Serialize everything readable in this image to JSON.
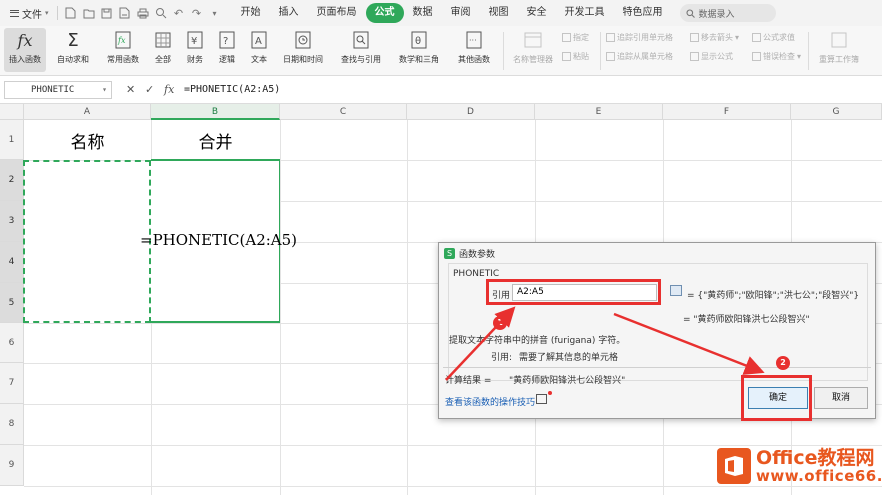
{
  "menubar": {
    "file_label": "文件",
    "tabs": [
      "开始",
      "插入",
      "页面布局",
      "公式",
      "数据",
      "审阅",
      "视图",
      "安全",
      "开发工具",
      "特色应用"
    ],
    "active_tab": "公式",
    "search_placeholder": "数据录入"
  },
  "ribbon": {
    "insert_function": "插入函数",
    "autosum": "自动求和",
    "common_functions": "常用函数",
    "all": "全部",
    "finance": "财务",
    "logic": "逻辑",
    "text": "文本",
    "datetime": "日期和时间",
    "lookup": "查找与引用",
    "math": "数学和三角",
    "other": "其他函数",
    "name_manager": "名称管理器",
    "specify": "指定",
    "paste": "粘贴",
    "trace_precedents": "追踪引用单元格",
    "trace_dependents": "追踪从属单元格",
    "remove_arrows": "移去箭头",
    "show_formulas": "显示公式",
    "formula_eval": "公式求值",
    "error_check": "错误检查",
    "recalc": "重算工作簿"
  },
  "formula_bar": {
    "name_box": "PHONETIC",
    "formula": "=PHONETIC(A2:A5)",
    "fx_label": "fx"
  },
  "grid": {
    "columns": [
      "A",
      "B",
      "C",
      "D",
      "E",
      "F",
      "G"
    ],
    "rows": [
      "1",
      "2",
      "3",
      "4",
      "5",
      "6",
      "7",
      "8",
      "9"
    ],
    "a1": "名称",
    "b1": "合并",
    "b_formula": "=PHONETIC(A2:A5)"
  },
  "dialog": {
    "title": "函数参数",
    "function_name": "PHONETIC",
    "ref_label": "引用",
    "ref_value": "A2:A5",
    "ref_preview": "= {\"黄药师\";\"欧阳锋\";\"洪七公\";\"段智兴\"}",
    "result_preview": "= \"黄药师欧阳锋洪七公段智兴\"",
    "description": "提取文本字符串中的拼音 (furigana) 字符。",
    "arg_help_label": "引用:",
    "arg_help_text": "需要了解其信息的单元格",
    "calc_result_label": "计算结果 =",
    "calc_result_value": "\"黄药师欧阳锋洪七公段智兴\"",
    "help_link": "查看该函数的操作技巧",
    "ok": "确定",
    "cancel": "取消"
  },
  "annotations": {
    "badge1": "1",
    "badge2": "2",
    "color": "#e8302f"
  },
  "watermark": {
    "line1": "Office教程网",
    "line2": "www.office66.cn"
  },
  "colors": {
    "accent": "#2fa85a",
    "annotation": "#e8302f",
    "watermark": "#e8571f"
  }
}
